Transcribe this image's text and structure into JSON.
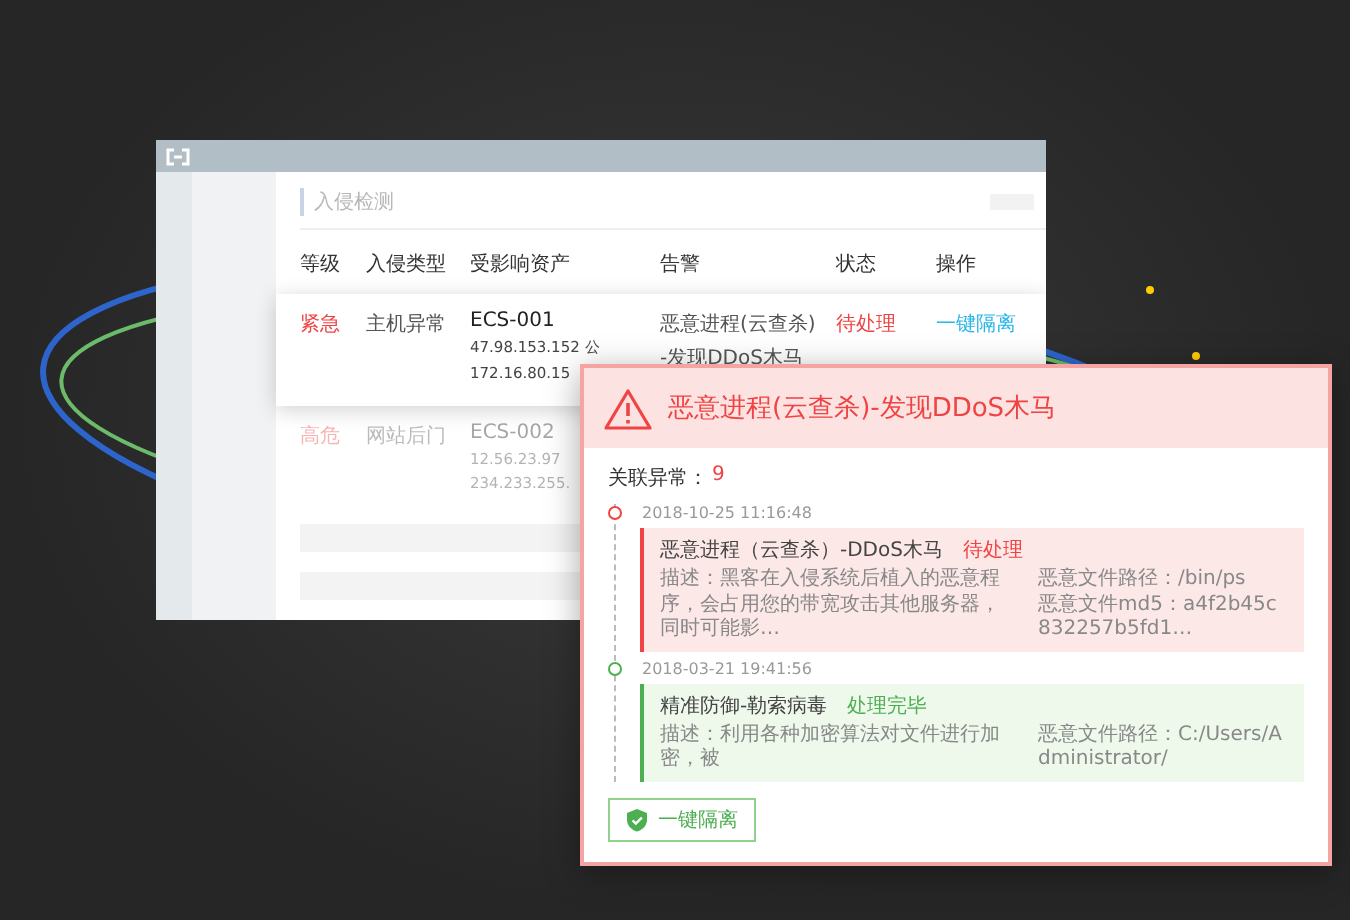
{
  "page_title": "入侵检测",
  "table": {
    "columns": [
      "等级",
      "入侵类型",
      "受影响资产",
      "告警",
      "状态",
      "操作"
    ],
    "rows": [
      {
        "selected": true,
        "level": "紧急",
        "type": "主机异常",
        "asset": "ECS-001",
        "ips": [
          "47.98.153.152 公",
          "172.16.80.15"
        ],
        "alert": [
          "恶意进程(云查杀)",
          "-发现DDoS木马"
        ],
        "status": "待处理",
        "action": "一键隔离"
      },
      {
        "selected": false,
        "level": "高危",
        "type": "网站后门",
        "asset": "ECS-002",
        "ips": [
          "12.56.23.97",
          "234.233.255."
        ]
      }
    ]
  },
  "popup": {
    "title": "恶意进程(云查杀)-发现DDoS木马",
    "related_label": "关联异常：",
    "related_count": "9",
    "events": [
      {
        "kind": "pending",
        "time": "2018-10-25 11:16:48",
        "name": "恶意进程（云查杀）-DDoS木马",
        "status": "待处理",
        "description": "描述：黑客在入侵系统后植入的恶意程序，会占用您的带宽攻击其他服务器，同时可能影…",
        "details": [
          "恶意文件路径：/bin/ps",
          "恶意文件md5：a4f2b45c832257b5fd1…"
        ]
      },
      {
        "kind": "done",
        "time": "2018-03-21 19:41:56",
        "name": "精准防御-勒索病毒",
        "status": "处理完毕",
        "description": "描述：利用各种加密算法对文件进行加密，被",
        "details": [
          "恶意文件路径：C:/Users/Administrator/"
        ]
      }
    ],
    "button": "一键隔离"
  }
}
